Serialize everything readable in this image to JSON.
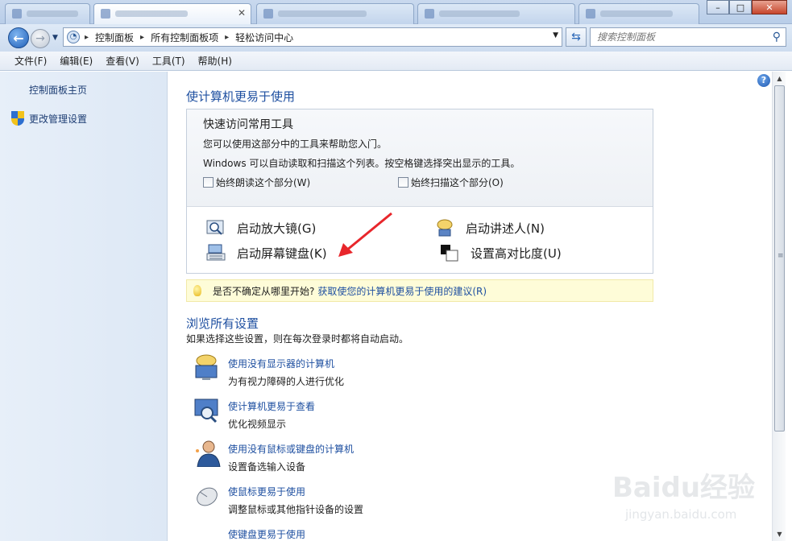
{
  "window": {
    "tabs": [
      {
        "active": false
      },
      {
        "active": true
      },
      {
        "active": false
      },
      {
        "active": false
      },
      {
        "active": false
      }
    ],
    "controls": {
      "minimize": "–",
      "maximize": "□",
      "close": "✕"
    }
  },
  "nav": {
    "breadcrumbs": [
      "控制面板",
      "所有控制面板项",
      "轻松访问中心"
    ],
    "search_placeholder": "搜索控制面板"
  },
  "menu": [
    "文件(F)",
    "编辑(E)",
    "查看(V)",
    "工具(T)",
    "帮助(H)"
  ],
  "left_pane": {
    "home_link": "控制面板主页",
    "admin_link": "更改管理设置"
  },
  "main": {
    "heading": "使计算机更易于使用",
    "quick": {
      "title": "快速访问常用工具",
      "line1": "您可以使用这部分中的工具来帮助您入门。",
      "line2": "Windows 可以自动读取和扫描这个列表。按空格键选择突出显示的工具。",
      "check_read": "始终朗读这个部分(W)",
      "check_scan": "始终扫描这个部分(O)",
      "tools": {
        "magnifier": "启动放大镜(G)",
        "narrator": "启动讲述人(N)",
        "osk": "启动屏幕键盘(K)",
        "contrast": "设置高对比度(U)"
      }
    },
    "tip": {
      "text": "是否不确定从哪里开始?",
      "link": "获取使您的计算机更易于使用的建议(R)"
    },
    "browse": {
      "heading": "浏览所有设置",
      "subtext": "如果选择这些设置，则在每次登录时都将自动启动。",
      "items": [
        {
          "link": "使用没有显示器的计算机",
          "desc": "为有视力障碍的人进行优化"
        },
        {
          "link": "使计算机更易于查看",
          "desc": "优化视频显示"
        },
        {
          "link": "使用没有鼠标或键盘的计算机",
          "desc": "设置备选输入设备"
        },
        {
          "link": "使鼠标更易于使用",
          "desc": "调整鼠标或其他指针设备的设置"
        },
        {
          "link": "使键盘更易于使用",
          "desc": ""
        }
      ]
    }
  },
  "watermark": {
    "logo": "Baidu经验",
    "url": "jingyan.baidu.com"
  },
  "colors": {
    "link": "#1e4fa0",
    "annotation_arrow": "#e8262b",
    "tip_bg": "#fefcd8"
  }
}
